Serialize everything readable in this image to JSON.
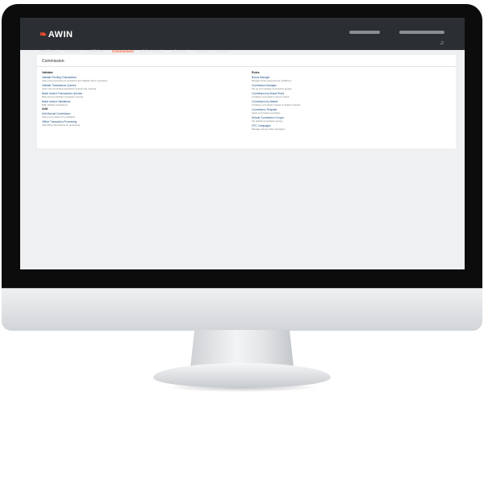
{
  "logo": {
    "text": "AWIN"
  },
  "nav": {
    "items": [
      "Dashboard",
      "Account",
      "Publishers",
      "Commission",
      "Links & Tools",
      "Advanced",
      "Support",
      "Reports"
    ],
    "active_index": 3
  },
  "panel": {
    "title": "Commission",
    "left": [
      {
        "kind": "heading",
        "text": "Validate"
      },
      {
        "kind": "title",
        "text": "Validate Pending Transactions"
      },
      {
        "kind": "desc",
        "text": "View a list of pending commissions and validate where necessary"
      },
      {
        "kind": "title",
        "text": "Validate Transactions Queries"
      },
      {
        "kind": "desc",
        "text": "View a list of pending transaction queries and respond"
      },
      {
        "kind": "title",
        "text": "Batch Amend Transactions Queries"
      },
      {
        "kind": "desc",
        "text": "Bulk amend publisher transaction queries"
      },
      {
        "kind": "title",
        "text": "Batch Amend Validations"
      },
      {
        "kind": "desc",
        "text": "Bulk validate transactions"
      },
      {
        "kind": "heading",
        "text": "Add"
      },
      {
        "kind": "title",
        "text": "Add Manual Commission"
      },
      {
        "kind": "desc",
        "text": "Add a commission for a publisher"
      },
      {
        "kind": "title",
        "text": "Offline Transaction Processing"
      },
      {
        "kind": "desc",
        "text": "Add offline transactions for processing"
      }
    ],
    "right": [
      {
        "kind": "heading",
        "text": "Rules"
      },
      {
        "kind": "title",
        "text": "Bonus Manager"
      },
      {
        "kind": "desc",
        "text": "Manage bonus payments for publishers"
      },
      {
        "kind": "title",
        "text": "Commission Manager"
      },
      {
        "kind": "desc",
        "text": "Set up and manage commission groups"
      },
      {
        "kind": "title",
        "text": "Commission by Brand Rules"
      },
      {
        "kind": "desc",
        "text": "Configure commission rates by brand"
      },
      {
        "kind": "title",
        "text": "Commission by Basket"
      },
      {
        "kind": "desc",
        "text": "Configure commission based on basket contents"
      },
      {
        "kind": "title",
        "text": "Commission Template"
      },
      {
        "kind": "desc",
        "text": "Apply commission templates"
      },
      {
        "kind": "title",
        "text": "Default Commission Groups"
      },
      {
        "kind": "desc",
        "text": "Set default commission groups"
      },
      {
        "kind": "title",
        "text": "CPC Campaigns"
      },
      {
        "kind": "desc",
        "text": "Manage cost per click campaigns"
      }
    ]
  }
}
